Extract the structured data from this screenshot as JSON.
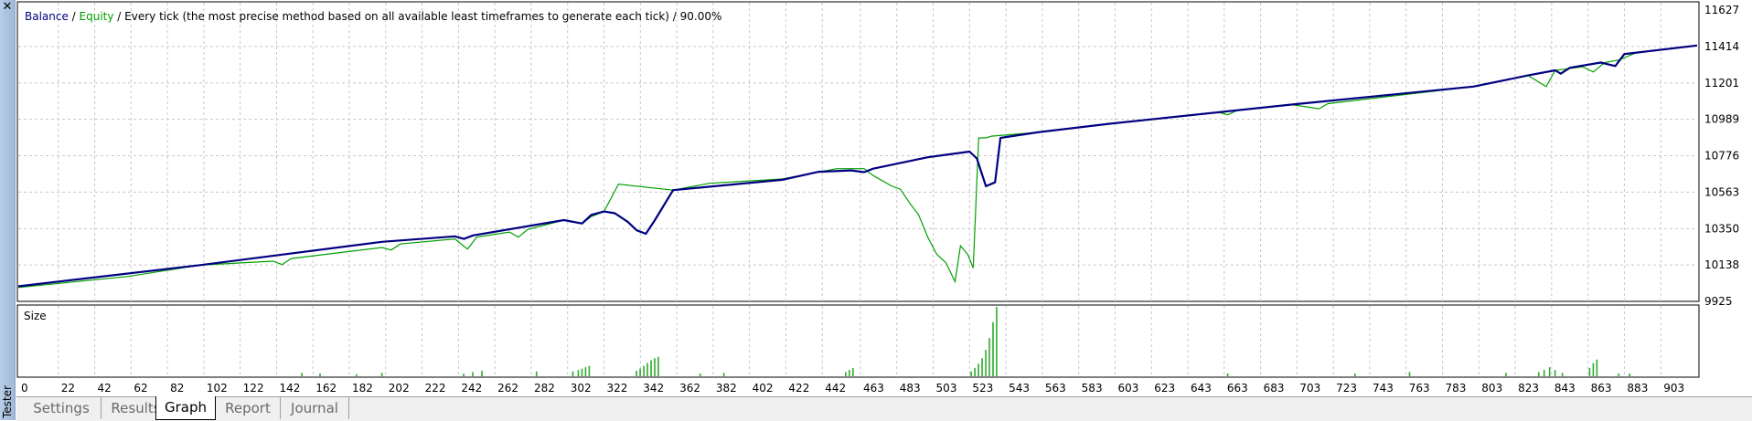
{
  "window": {
    "close_icon": "close-icon",
    "side_label": "Tester"
  },
  "legend": {
    "balance_label": "Balance",
    "separator": " / ",
    "equity_label": "Equity",
    "description": " / Every tick (the most precise method based on all available least timeframes to generate each tick) / 90.00%"
  },
  "colors": {
    "balance": "#000080",
    "equity": "#00a000",
    "grid": "#c8c8c8",
    "size_bars": "#2eaa2e"
  },
  "tabs": [
    "Settings",
    "Results",
    "Graph",
    "Report",
    "Journal"
  ],
  "active_tab": "Graph",
  "chart_data": [
    {
      "type": "line",
      "title": "",
      "legend": [
        "Balance",
        "Equity"
      ],
      "y_ticks": [
        11627,
        11414,
        11201,
        10989,
        10776,
        10563,
        10350,
        10138,
        9925
      ],
      "ylim": [
        9925,
        11627
      ],
      "xlim": [
        0,
        923
      ],
      "grid": true,
      "series": [
        {
          "name": "Balance",
          "points": [
            [
              0,
              10013
            ],
            [
              100,
              10137
            ],
            [
              200,
              10273
            ],
            [
              240,
              10305
            ],
            [
              245,
              10290
            ],
            [
              250,
              10310
            ],
            [
              300,
              10400
            ],
            [
              310,
              10380
            ],
            [
              315,
              10430
            ],
            [
              322,
              10450
            ],
            [
              328,
              10440
            ],
            [
              335,
              10390
            ],
            [
              340,
              10340
            ],
            [
              345,
              10320
            ],
            [
              350,
              10400
            ],
            [
              360,
              10575
            ],
            [
              420,
              10635
            ],
            [
              440,
              10682
            ],
            [
              458,
              10690
            ],
            [
              465,
              10680
            ],
            [
              470,
              10700
            ],
            [
              500,
              10767
            ],
            [
              523,
              10800
            ],
            [
              527,
              10760
            ],
            [
              532,
              10598
            ],
            [
              537,
              10620
            ],
            [
              540,
              10880
            ],
            [
              560,
              10912
            ],
            [
              600,
              10963
            ],
            [
              700,
              11075
            ],
            [
              800,
              11180
            ],
            [
              830,
              11245
            ],
            [
              845,
              11275
            ],
            [
              848,
              11255
            ],
            [
              853,
              11290
            ],
            [
              870,
              11320
            ],
            [
              878,
              11300
            ],
            [
              883,
              11370
            ],
            [
              923,
              11420
            ]
          ]
        },
        {
          "name": "Equity",
          "points": [
            [
              0,
              10006
            ],
            [
              60,
              10070
            ],
            [
              100,
              10137
            ],
            [
              140,
              10160
            ],
            [
              145,
              10140
            ],
            [
              150,
              10175
            ],
            [
              200,
              10240
            ],
            [
              205,
              10225
            ],
            [
              210,
              10260
            ],
            [
              240,
              10290
            ],
            [
              247,
              10230
            ],
            [
              252,
              10300
            ],
            [
              270,
              10330
            ],
            [
              275,
              10300
            ],
            [
              280,
              10345
            ],
            [
              300,
              10400
            ],
            [
              310,
              10380
            ],
            [
              315,
              10420
            ],
            [
              322,
              10450
            ],
            [
              330,
              10610
            ],
            [
              360,
              10575
            ],
            [
              380,
              10615
            ],
            [
              420,
              10640
            ],
            [
              450,
              10700
            ],
            [
              458,
              10700
            ],
            [
              465,
              10700
            ],
            [
              470,
              10660
            ],
            [
              480,
              10600
            ],
            [
              485,
              10580
            ],
            [
              490,
              10500
            ],
            [
              495,
              10430
            ],
            [
              500,
              10300
            ],
            [
              505,
              10200
            ],
            [
              510,
              10150
            ],
            [
              515,
              10040
            ],
            [
              518,
              10250
            ],
            [
              522,
              10200
            ],
            [
              525,
              10120
            ],
            [
              528,
              10880
            ],
            [
              532,
              10880
            ],
            [
              535,
              10890
            ],
            [
              560,
              10912
            ],
            [
              600,
              10963
            ],
            [
              660,
              11030
            ],
            [
              665,
              11015
            ],
            [
              670,
              11040
            ],
            [
              700,
              11075
            ],
            [
              715,
              11050
            ],
            [
              720,
              11080
            ],
            [
              800,
              11180
            ],
            [
              830,
              11245
            ],
            [
              840,
              11180
            ],
            [
              845,
              11275
            ],
            [
              860,
              11295
            ],
            [
              866,
              11265
            ],
            [
              872,
              11320
            ],
            [
              880,
              11335
            ],
            [
              890,
              11380
            ],
            [
              923,
              11420
            ]
          ]
        }
      ]
    },
    {
      "type": "bar",
      "title": "Size",
      "x_ticks": [
        0,
        22,
        42,
        62,
        82,
        102,
        122,
        142,
        162,
        182,
        202,
        222,
        242,
        262,
        282,
        302,
        322,
        342,
        362,
        382,
        402,
        422,
        442,
        463,
        483,
        503,
        523,
        543,
        563,
        583,
        603,
        623,
        643,
        663,
        683,
        703,
        723,
        743,
        763,
        783,
        803,
        823,
        843,
        863,
        883,
        903
      ],
      "xlim": [
        0,
        923
      ],
      "ylim": [
        0,
        1
      ],
      "bars": [
        [
          156,
          0.05
        ],
        [
          166,
          0.04
        ],
        [
          186,
          0.03
        ],
        [
          200,
          0.05
        ],
        [
          245,
          0.04
        ],
        [
          250,
          0.06
        ],
        [
          255,
          0.08
        ],
        [
          285,
          0.07
        ],
        [
          305,
          0.07
        ],
        [
          308,
          0.09
        ],
        [
          310,
          0.11
        ],
        [
          312,
          0.13
        ],
        [
          314,
          0.15
        ],
        [
          340,
          0.08
        ],
        [
          342,
          0.11
        ],
        [
          344,
          0.15
        ],
        [
          346,
          0.19
        ],
        [
          348,
          0.23
        ],
        [
          350,
          0.26
        ],
        [
          352,
          0.28
        ],
        [
          375,
          0.04
        ],
        [
          388,
          0.05
        ],
        [
          455,
          0.06
        ],
        [
          457,
          0.09
        ],
        [
          459,
          0.12
        ],
        [
          524,
          0.07
        ],
        [
          526,
          0.12
        ],
        [
          528,
          0.18
        ],
        [
          530,
          0.26
        ],
        [
          532,
          0.38
        ],
        [
          534,
          0.55
        ],
        [
          536,
          0.78
        ],
        [
          538,
          1.0
        ],
        [
          665,
          0.04
        ],
        [
          735,
          0.04
        ],
        [
          765,
          0.06
        ],
        [
          818,
          0.05
        ],
        [
          836,
          0.06
        ],
        [
          839,
          0.09
        ],
        [
          842,
          0.13
        ],
        [
          845,
          0.09
        ],
        [
          849,
          0.05
        ],
        [
          864,
          0.12
        ],
        [
          866,
          0.19
        ],
        [
          868,
          0.24
        ],
        [
          880,
          0.04
        ],
        [
          886,
          0.04
        ]
      ]
    }
  ]
}
